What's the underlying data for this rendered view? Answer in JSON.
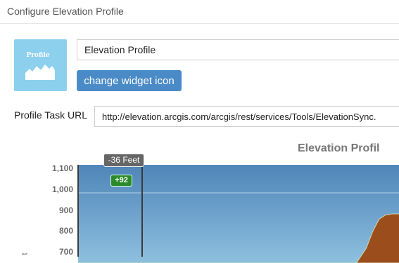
{
  "dialog": {
    "title": "Configure Elevation Profile"
  },
  "widget": {
    "icon_text": "Profile",
    "icon_name": "mountain-profile-icon",
    "icon_bg_color": "#8dd0ee",
    "name_value": "Elevation Profile",
    "change_icon_label": "change widget icon"
  },
  "task_url": {
    "label": "Profile Task URL",
    "value": "http://elevation.arcgis.com/arcgis/rest/services/Tools/ElevationSync."
  },
  "chart": {
    "cursor_label": "-36 Feet",
    "delta_badge": "+92",
    "ylabel_fragment": "t"
  },
  "chart_data": {
    "type": "area",
    "title": "Elevation Profil",
    "ylabel": "",
    "yticks": [
      "1,100",
      "1,000",
      "900",
      "800",
      "700"
    ],
    "ylim": [
      650,
      1120
    ],
    "x": [
      0,
      0.86,
      0.89,
      0.91,
      0.93,
      0.95,
      0.97,
      1.0
    ],
    "y": [
      650,
      650,
      720,
      800,
      860,
      880,
      885,
      885
    ],
    "area_color": "#9b4e1c",
    "background_top_color": "#4f85b8",
    "background_bottom_color": "#8ec0df"
  }
}
